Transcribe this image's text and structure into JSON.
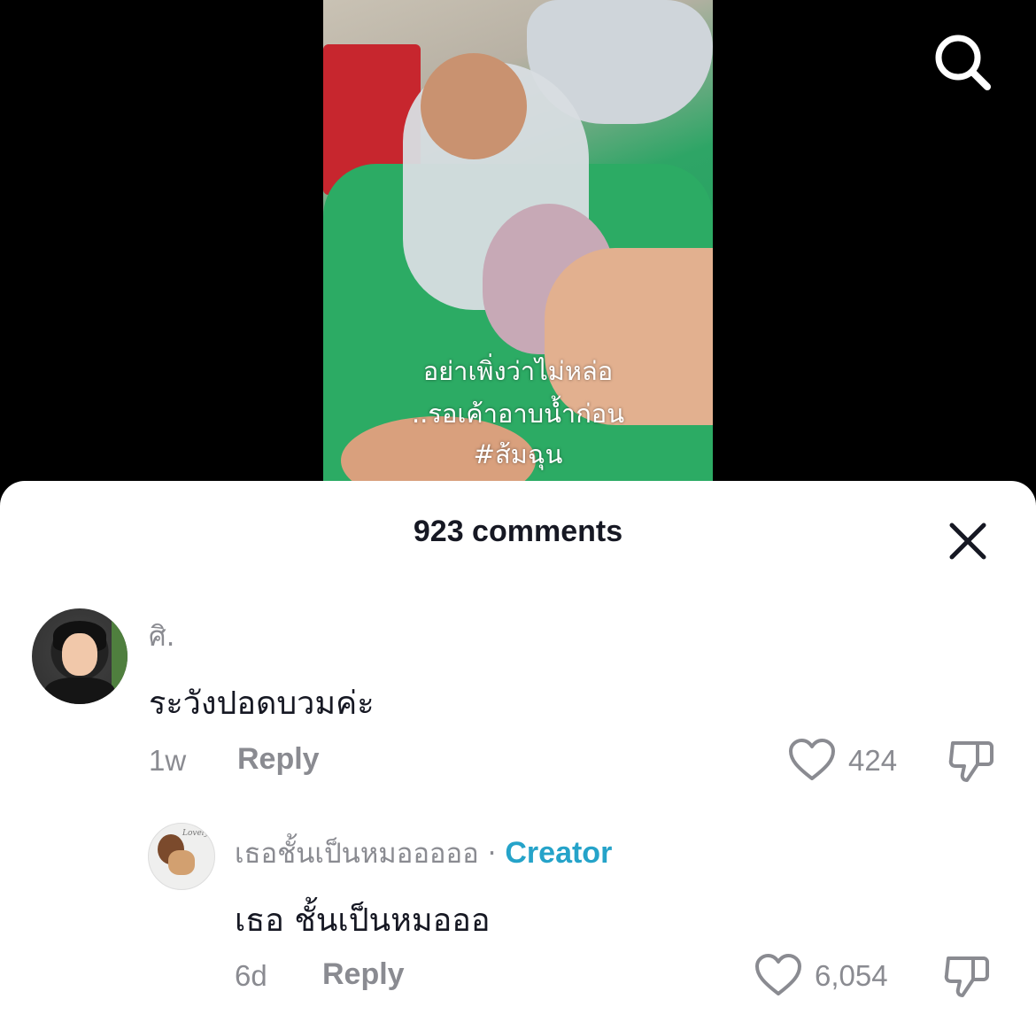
{
  "video": {
    "caption_lines": [
      "อย่าเพิ่งว่าไม่หล่อ",
      "..รอเค้าอาบน้ำก่อน",
      "#ส้มฉุน"
    ]
  },
  "icons": {
    "search": "search-icon",
    "close": "close-icon",
    "heart": "heart-icon",
    "dislike": "dislike-icon"
  },
  "colors": {
    "creator_accent": "#25a3c9",
    "muted_text": "#8a8b91",
    "primary_text": "#161823"
  },
  "comments_panel": {
    "title": "923 comments",
    "comments": [
      {
        "username": "ศิ.",
        "text": "ระวังปอดบวมค่ะ",
        "time": "1w",
        "reply_label": "Reply",
        "likes": "424"
      }
    ],
    "replies": [
      {
        "username": "เธอชั้นเป็นหมอออออ",
        "separator": "·",
        "badge": "Creator",
        "text": "เธอ ชั้นเป็นหมอออ",
        "time": "6d",
        "reply_label": "Reply",
        "likes": "6,054"
      }
    ]
  }
}
